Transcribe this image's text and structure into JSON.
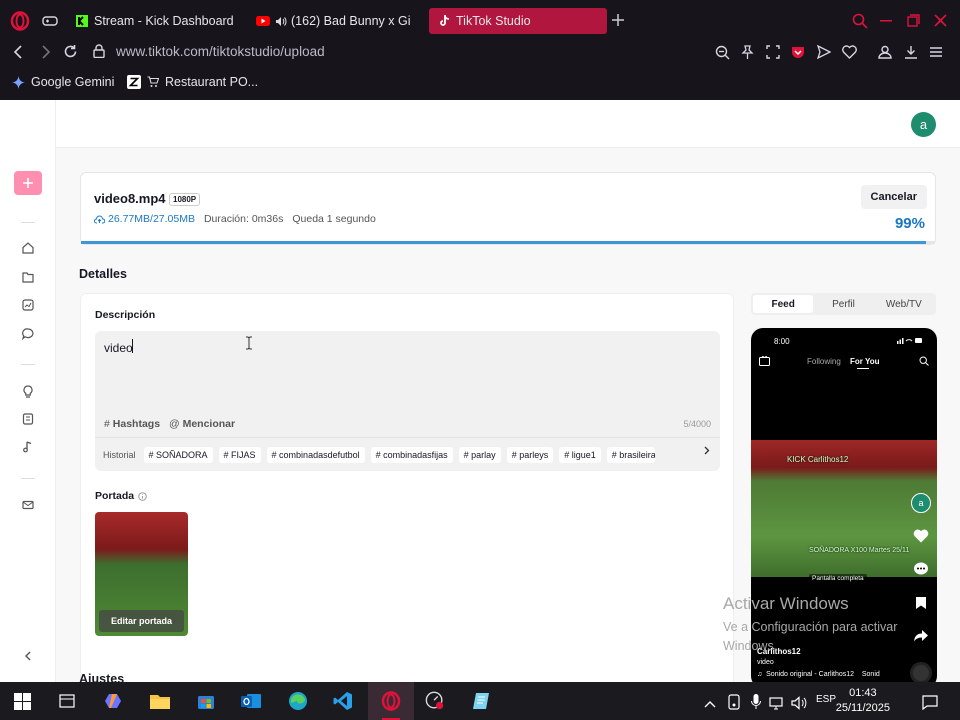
{
  "browser": {
    "tabs": [
      {
        "label": "Stream - Kick Dashboard",
        "favicon": "kick-icon"
      },
      {
        "label": "(162) Bad Bunny x Gi",
        "favicon": "youtube-icon"
      },
      {
        "label": "TikTok Studio",
        "favicon": "tiktok-icon",
        "active": true
      }
    ],
    "url": "www.tiktok.com/tiktokstudio/upload",
    "bookmarks": [
      {
        "label": "Google Gemini",
        "icon": "gemini-icon"
      },
      {
        "label": "Restaurant PO...",
        "icon": "cart-icon"
      }
    ]
  },
  "header": {
    "avatar_letter": "a"
  },
  "upload": {
    "filename": "video8.mp4",
    "resolution": "1080P",
    "size": "26.77MB/27.05MB",
    "duration": "Duración: 0m36s",
    "remaining": "Queda 1 segundo",
    "cancel_label": "Cancelar",
    "percent": "99%",
    "progress": 0.99
  },
  "details": {
    "title": "Detalles",
    "description_label": "Descripción",
    "description_value": "video",
    "hashtags_label": "Hashtags",
    "mention_label": "Mencionar",
    "char_count": "5/4000",
    "history_label": "Historial",
    "suggested_tags": [
      "# SOÑADORA",
      "# FIJAS",
      "# combinadasdefutbol",
      "# combinadasfijas",
      "# parlay",
      "# parleys",
      "# ligue1",
      "# brasileirao"
    ],
    "cover_label": "Portada",
    "edit_cover_label": "Editar portada",
    "settings_title": "Ajustes"
  },
  "preview": {
    "tabs": [
      "Feed",
      "Perfil",
      "Web/TV"
    ],
    "active_tab": "Feed",
    "time": "8:00",
    "following": "Following",
    "for_you": "For You",
    "video_caption_top": "KICK Carlithos12",
    "video_caption_bottom": "SOÑADORA X100 Martes 25/11",
    "fullscreen_label": "Pantalla completa",
    "username": "Carlithos12",
    "video_title": "video",
    "sound": "Sonido original - Carlithos12",
    "sound_tail": "Sonid",
    "avatar_letter": "a"
  },
  "watermark": {
    "line1": "Activar Windows",
    "line2": "Ve a Configuración para activar",
    "line3": "Windows."
  },
  "taskbar": {
    "language": "ESP",
    "time": "01:43",
    "date": "25/11/2025"
  },
  "colors": {
    "accent": "#fe2c55",
    "progress": "#3f97d6",
    "browser_active_tab": "#b0163e"
  }
}
